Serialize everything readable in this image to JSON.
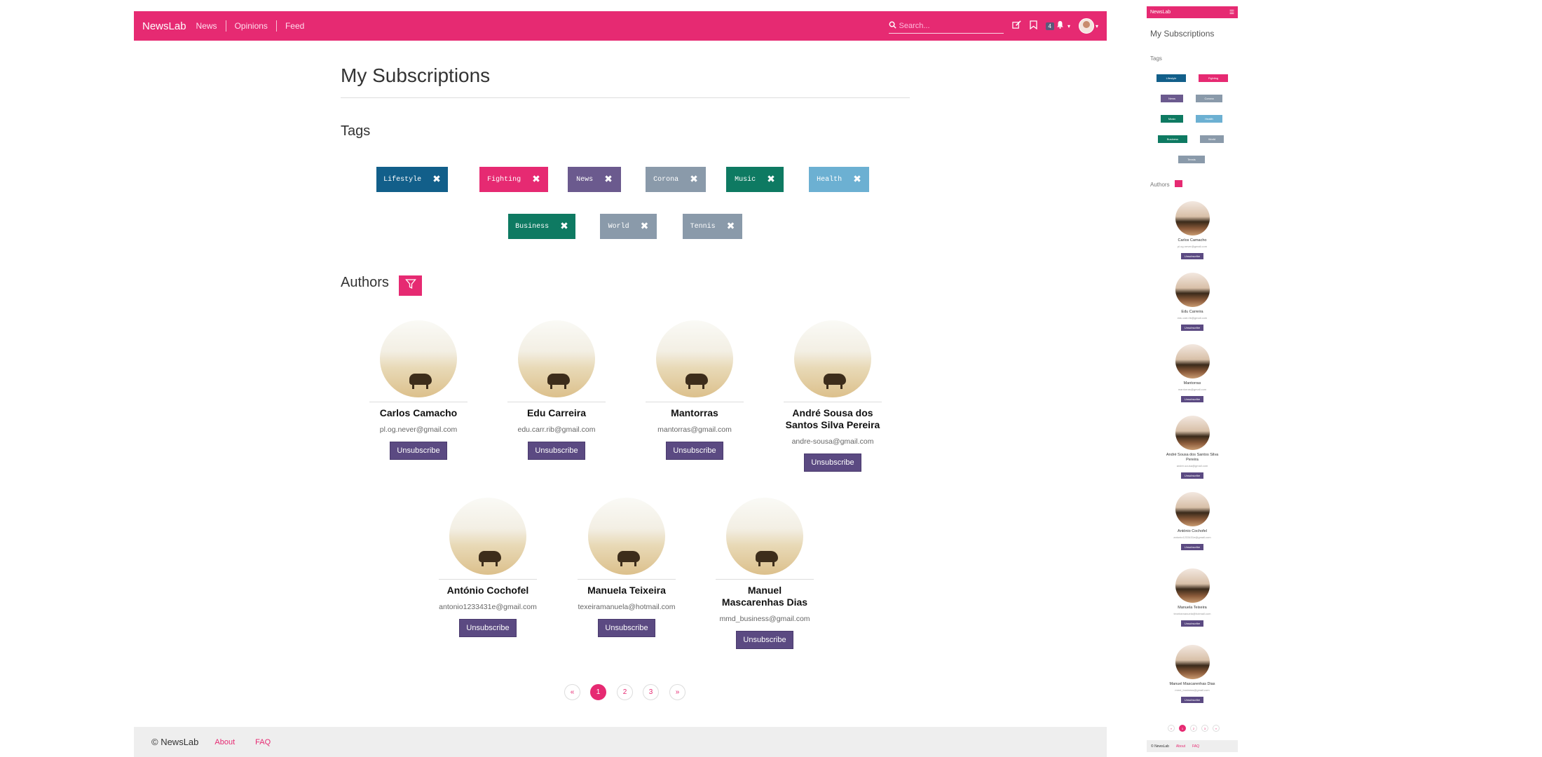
{
  "navbar": {
    "brand": "NewsLab",
    "links": [
      "News",
      "Opinions",
      "Feed"
    ],
    "search_placeholder": "Search...",
    "notification_count": "4"
  },
  "page": {
    "title": "My Subscriptions",
    "tags_heading": "Tags",
    "authors_heading": "Authors"
  },
  "tags": [
    {
      "label": "Lifestyle",
      "color": "#125f8a"
    },
    {
      "label": "Fighting",
      "color": "#e62a72"
    },
    {
      "label": "News",
      "color": "#6b5a8e"
    },
    {
      "label": "Corona",
      "color": "#8a9aaa"
    },
    {
      "label": "Music",
      "color": "#0e7a62"
    },
    {
      "label": "Health",
      "color": "#6cb0d2"
    },
    {
      "label": "Business",
      "color": "#0e7a62"
    },
    {
      "label": "World",
      "color": "#8a9aaa"
    },
    {
      "label": "Tennis",
      "color": "#8a9aaa"
    }
  ],
  "authors": [
    {
      "name": "Carlos Camacho",
      "email": "pl.og.never@gmail.com"
    },
    {
      "name": "Edu Carreira",
      "email": "edu.carr.rib@gmail.com"
    },
    {
      "name": "Mantorras",
      "email": "mantorras@gmail.com"
    },
    {
      "name": "André Sousa dos Santos Silva Pereira",
      "email": "andre-sousa@gmail.com"
    },
    {
      "name": "António Cochofel",
      "email": "antonio1233431e@gmail.com"
    },
    {
      "name": "Manuela Teixeira",
      "email": "texeiramanuela@hotmail.com"
    },
    {
      "name": "Manuel Mascarenhas Dias",
      "email": "mmd_business@gmail.com"
    }
  ],
  "unsubscribe_label": "Unsubscribe",
  "pagination": {
    "prev": "«",
    "pages": [
      "1",
      "2",
      "3"
    ],
    "next": "»",
    "current": "1"
  },
  "footer": {
    "copyright": "© NewsLab",
    "links": [
      "About",
      "FAQ"
    ]
  },
  "mobile": {
    "brand": "NewsLab",
    "title": "My Subscriptions",
    "tags_heading": "Tags",
    "authors_heading": "Authors",
    "footer_copyright": "© NewsLab",
    "footer_links": [
      "About",
      "FAQ"
    ]
  }
}
